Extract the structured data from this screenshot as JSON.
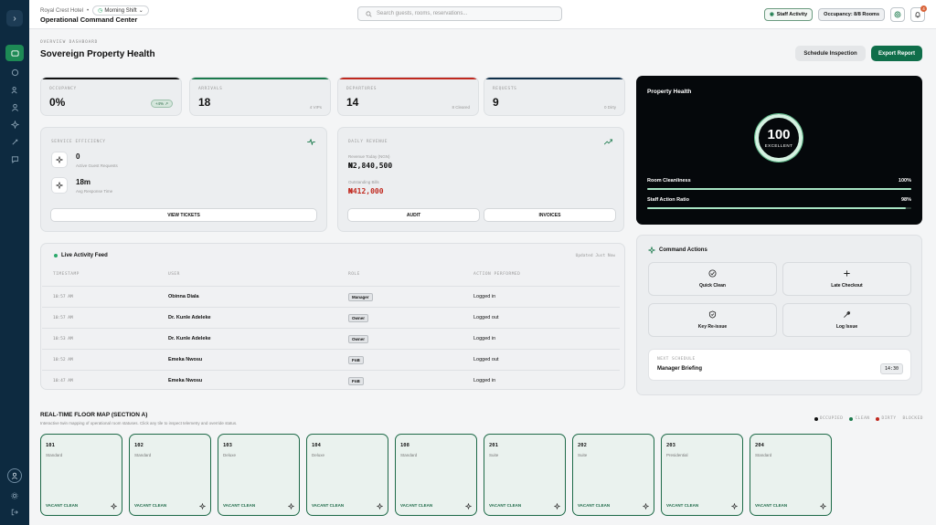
{
  "header": {
    "hotel": "Royal Crest Hotel",
    "shift": "Morning Shift",
    "title": "Operational Command Center",
    "search_placeholder": "Search guests, rooms, reservations...",
    "staff_activity": "Staff Activity",
    "occupancy_pill": "Occupancy: 8/8 Rooms",
    "notification_count": "4"
  },
  "page": {
    "overline": "OVERVIEW DASHBOARD",
    "title": "Sovereign Property Health",
    "schedule_btn": "Schedule Inspection",
    "export_btn": "Export Report"
  },
  "stats": [
    {
      "label": "OCCUPANCY",
      "value": "0%",
      "delta": "+4%",
      "color": "#111111"
    },
    {
      "label": "ARRIVALS",
      "value": "18",
      "sub": "4 VIPs",
      "color": "#1b7a4c"
    },
    {
      "label": "DEPARTURES",
      "value": "14",
      "sub": "8 Cleared",
      "color": "#c0281e"
    },
    {
      "label": "REQUESTS",
      "value": "9",
      "sub": "0 Dirty",
      "color": "#0f2f4a"
    }
  ],
  "service": {
    "label": "SERVICE EFFICIENCY",
    "active_value": "0",
    "active_label": "Active Guest Requests",
    "response_value": "18m",
    "response_label": "Avg Response Time",
    "button": "VIEW TICKETS"
  },
  "revenue": {
    "label": "DAILY REVENUE",
    "today_label": "Revenue Today (NGN)",
    "today_value": "₦2,840,500",
    "outstanding_label": "Outstanding Bills",
    "outstanding_value": "₦412,000",
    "audit_btn": "AUDIT",
    "invoices_btn": "INVOICES"
  },
  "health": {
    "title": "Property Health",
    "score": "100",
    "status": "EXCELLENT",
    "metrics": [
      {
        "label": "Room Cleanliness",
        "value": "100%",
        "fraction": 1.0
      },
      {
        "label": "Staff Action Ratio",
        "value": "98%",
        "fraction": 0.98
      }
    ]
  },
  "feed": {
    "title": "Live Activity Feed",
    "updated": "Updated Just Now",
    "columns": [
      "TIMESTAMP",
      "USER",
      "ROLE",
      "ACTION PERFORMED"
    ],
    "rows": [
      {
        "time": "10:57 AM",
        "user": "Obinna Diala",
        "role": "Manager",
        "action": "Logged in"
      },
      {
        "time": "10:57 AM",
        "user": "Dr. Kunle Adeleke",
        "role": "Owner",
        "action": "Logged out"
      },
      {
        "time": "10:53 AM",
        "user": "Dr. Kunle Adeleke",
        "role": "Owner",
        "action": "Logged in"
      },
      {
        "time": "10:52 AM",
        "user": "Emeka Nwosu",
        "role": "FnB",
        "action": "Logged out"
      },
      {
        "time": "10:47 AM",
        "user": "Emeka Nwosu",
        "role": "FnB",
        "action": "Logged in"
      }
    ]
  },
  "commands": {
    "title": "Command Actions",
    "actions": [
      "Quick Clean",
      "Late Checkout",
      "Key Re-issue",
      "Log Issue"
    ],
    "next_label": "NEXT SCHEDULE",
    "next_title": "Manager Briefing",
    "next_time": "14:30"
  },
  "floor": {
    "title": "REAL-TIME FLOOR MAP (SECTION A)",
    "subtitle": "Interactive twin mapping of operational room statuses. Click any tile to inspect telemetry and override status.",
    "legend": [
      {
        "label": "OCCUPIED",
        "color": "#111111"
      },
      {
        "label": "CLEAN",
        "color": "#1b7a4c"
      },
      {
        "label": "DIRTY",
        "color": "#c0281e"
      },
      {
        "label": "BLOCKED",
        "color": ""
      }
    ],
    "rooms": [
      {
        "num": "101",
        "type": "Standard",
        "status": "VACANT CLEAN"
      },
      {
        "num": "102",
        "type": "Standard",
        "status": "VACANT CLEAN"
      },
      {
        "num": "103",
        "type": "Deluxe",
        "status": "VACANT CLEAN"
      },
      {
        "num": "104",
        "type": "Deluxe",
        "status": "VACANT CLEAN"
      },
      {
        "num": "108",
        "type": "Standard",
        "status": "VACANT CLEAN"
      },
      {
        "num": "201",
        "type": "Suite",
        "status": "VACANT CLEAN"
      },
      {
        "num": "202",
        "type": "Suite",
        "status": "VACANT CLEAN"
      },
      {
        "num": "203",
        "type": "Presidential",
        "status": "VACANT CLEAN"
      },
      {
        "num": "204",
        "type": "Standard",
        "status": "VACANT CLEAN"
      }
    ]
  }
}
